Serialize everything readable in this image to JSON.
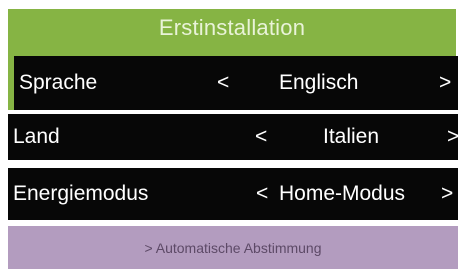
{
  "header": {
    "title": "Erstinstallation"
  },
  "settings": {
    "language": {
      "label": "Sprache",
      "prev": "<",
      "value": "Englisch",
      "next": ">"
    },
    "country": {
      "label": "Land",
      "prev": "<",
      "value": "Italien",
      "next": ">"
    },
    "energy_mode": {
      "label": "Energiemodus",
      "prev": "<",
      "value": "Home-Modus",
      "next": ">"
    }
  },
  "footer": {
    "text": "> Automatische Abstimmung"
  },
  "colors": {
    "header_green": "#86b444",
    "row_black": "#070707",
    "footer_purple": "#b39cbf",
    "footer_text": "#5d4a67"
  }
}
